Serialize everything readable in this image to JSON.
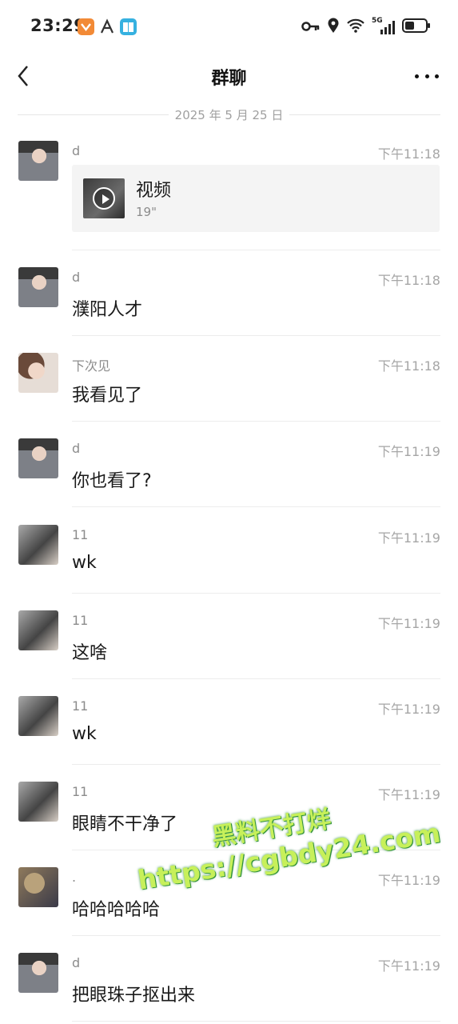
{
  "status_bar": {
    "time": "23:29",
    "network": "5G",
    "icons": [
      "orange-app-icon",
      "font-app-icon",
      "book-app-icon",
      "key-icon",
      "location-icon",
      "wifi-icon",
      "signal-icon",
      "battery-icon"
    ]
  },
  "header": {
    "title": "群聊",
    "back_icon": "chevron-left-icon",
    "more_icon": "more-dots-icon"
  },
  "date_divider": "2025 年 5 月 25 日",
  "messages": [
    {
      "sender": "d",
      "time": "下午11:18",
      "type": "video",
      "video_title": "视频",
      "video_duration": "19\""
    },
    {
      "sender": "d",
      "time": "下午11:18",
      "text": "濮阳人才"
    },
    {
      "sender": "下次见",
      "time": "下午11:18",
      "text": "我看见了"
    },
    {
      "sender": "d",
      "time": "下午11:19",
      "text": "你也看了?"
    },
    {
      "sender": "11",
      "time": "下午11:19",
      "text": "wk"
    },
    {
      "sender": "11",
      "time": "下午11:19",
      "text": "这啥"
    },
    {
      "sender": "11",
      "time": "下午11:19",
      "text": "wk"
    },
    {
      "sender": "11",
      "time": "下午11:19",
      "text": "眼睛不干净了"
    },
    {
      "sender": ".",
      "time": "下午11:19",
      "text": "哈哈哈哈哈"
    },
    {
      "sender": "d",
      "time": "下午11:19",
      "text": "把眼珠子抠出来"
    }
  ],
  "watermark": {
    "line1": "黑料不打烊",
    "line2": "https://cgbdy24.com"
  },
  "colors": {
    "background": "#ffffff",
    "secondary_text": "#8c8c8c",
    "divider": "#ececec",
    "watermark": "#c7f05a"
  }
}
